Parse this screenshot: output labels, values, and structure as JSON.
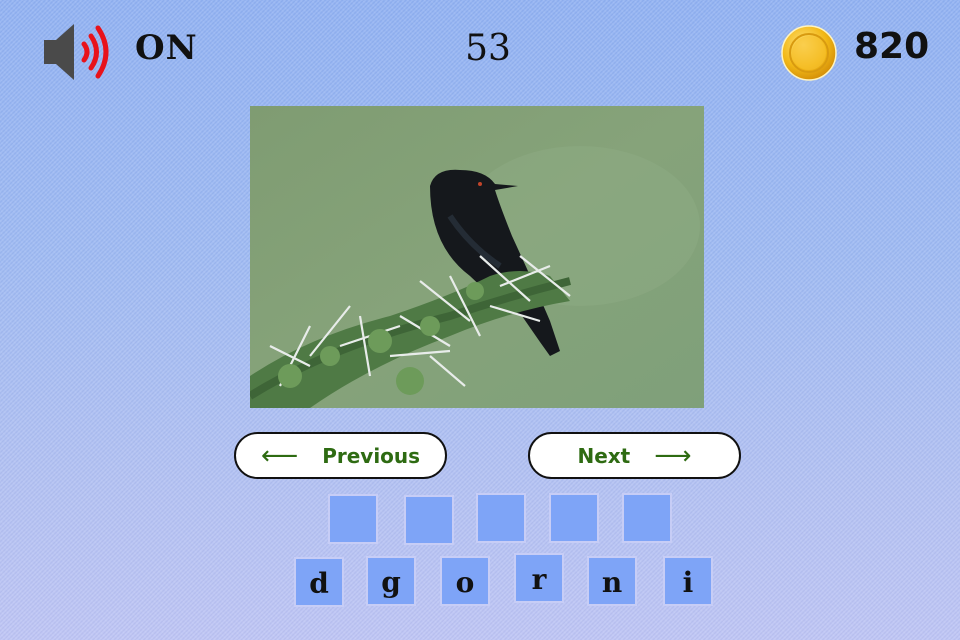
{
  "header": {
    "sound_icon": "speaker-volume-icon",
    "sound_state": "ON",
    "level": "53",
    "coin_icon": "gold-coin-icon",
    "coins": "820"
  },
  "puzzle": {
    "image_description": "black bird perched on a thorny acacia branch against a green background"
  },
  "navigation": {
    "previous_label": "Previous",
    "previous_arrow": "⟵",
    "next_label": "Next",
    "next_arrow": "⟶"
  },
  "answer_slots": [
    "",
    "",
    "",
    "",
    ""
  ],
  "letters": [
    "d",
    "g",
    "o",
    "r",
    "n",
    "i"
  ],
  "colors": {
    "tile": "#7ea4f7",
    "button_text": "#2e6b12",
    "speaker_waves": "#e8121b",
    "coin": "#f2b817"
  }
}
